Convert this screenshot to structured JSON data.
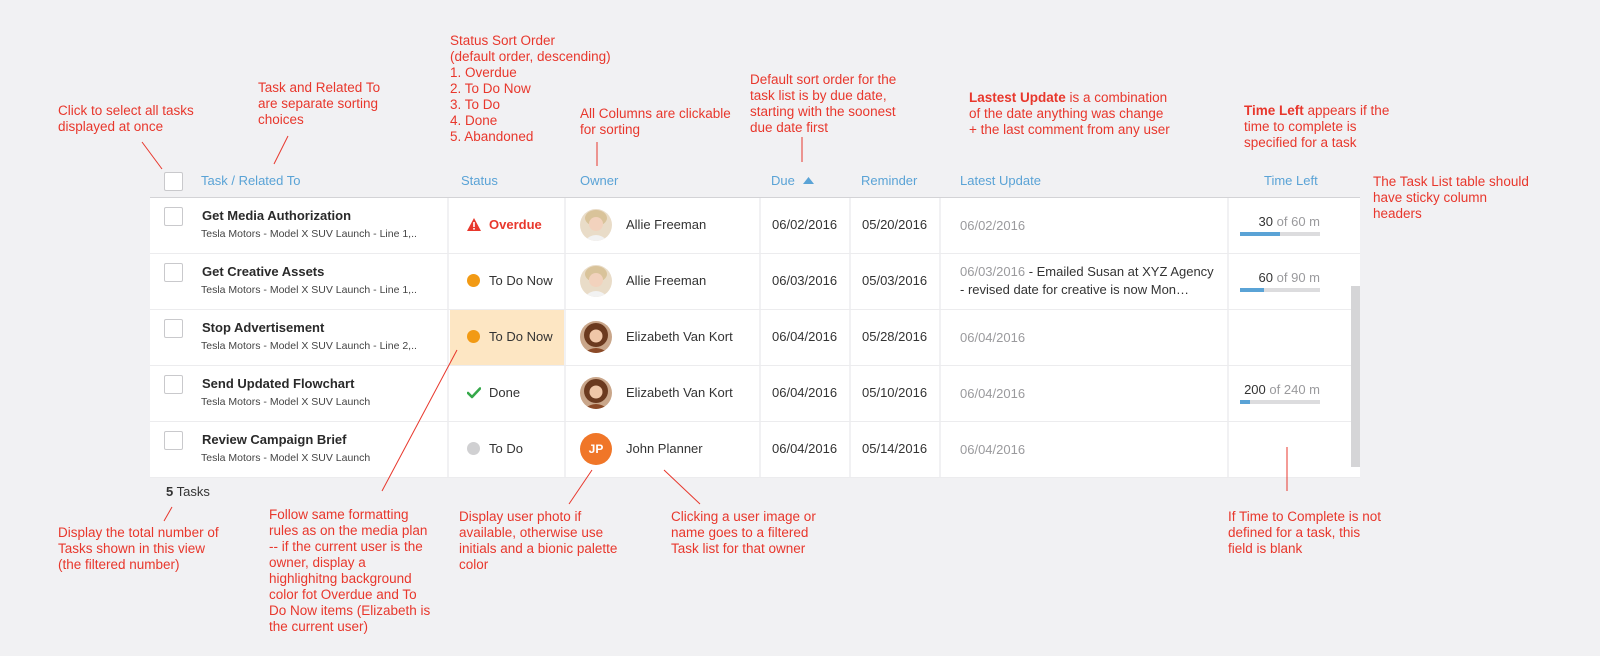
{
  "annotations": {
    "select_all": "Click to select all tasks\ndisplayed at once",
    "task_related": "Task and Related To\nare separate sorting\nchoices",
    "status_order": "Status Sort Order\n(default order, descending)\n1. Overdue\n2. To Do Now\n3. To Do\n4. Done\n5. Abandoned",
    "all_columns": "All Columns are clickable\nfor sorting",
    "default_sort": "Default sort order for the\ntask list is by due date,\nstarting with the soonest\ndue date first",
    "latest_update_bold": "Lastest Update",
    "latest_update_rest": " is a combination\nof the date anything was change\n+ the last comment from any user",
    "time_left_bold": "Time Left",
    "time_left_rest": " appears if the\ntime to complete is\nspecified for a task",
    "sticky": "The Task List table should\nhave sticky column\nheaders",
    "total_count": "Display the total number of\nTasks shown in this view\n(the filtered number)",
    "formatting": "Follow same formatting\nrules as on the media plan\n-- if the current user is the\nowner, display a\nhighlighitng background\ncolor fot Overdue and To\nDo Now items (Elizabeth is\nthe current user)",
    "user_photo": "Display user photo if\navailable, otherwise use\ninitials and a bionic palette\ncolor",
    "click_user": "Clicking a user image or\nname goes to a filtered\nTask list for that owner",
    "time_blank": "If Time to Complete is not\ndefined for a task, this\nfield is blank"
  },
  "headers": {
    "task": "Task / Related To",
    "status": "Status",
    "owner": "Owner",
    "due": "Due",
    "reminder": "Reminder",
    "latest_update": "Latest Update",
    "time_left": "Time Left"
  },
  "sort_icon": "caret-up-icon",
  "rows": [
    {
      "title": "Get Media Authorization",
      "related": "Tesla Motors - Model X SUV Launch - Line 1,..",
      "status": "Overdue",
      "status_icon": "warning-icon",
      "highlight": false,
      "owner": "Allie Freeman",
      "avatar": "photo-allie",
      "due": "06/02/2016",
      "reminder": "05/20/2016",
      "update_date": "06/02/2016",
      "update_comment": "",
      "time_used": "30",
      "time_total": "of 60 m",
      "time_fraction": 0.5
    },
    {
      "title": "Get Creative Assets",
      "related": "Tesla Motors - Model X SUV Launch - Line 1,..",
      "status": "To Do Now",
      "status_icon": "orange-dot-icon",
      "highlight": false,
      "owner": "Allie Freeman",
      "avatar": "photo-allie",
      "due": "06/03/2016",
      "reminder": "05/03/2016",
      "update_date": "06/03/2016",
      "update_comment": " - Emailed Susan at XYZ Agency - revised date for creative is now Mon…",
      "time_used": "60",
      "time_total": "of 90 m",
      "time_fraction": 0.3
    },
    {
      "title": "Stop Advertisement",
      "related": "Tesla Motors - Model X SUV Launch - Line 2,..",
      "status": "To Do Now",
      "status_icon": "orange-dot-icon",
      "highlight": true,
      "owner": "Elizabeth Van Kort",
      "avatar": "photo-elizabeth",
      "due": "06/04/2016",
      "reminder": "05/28/2016",
      "update_date": "06/04/2016",
      "update_comment": "",
      "time_used": "",
      "time_total": "",
      "time_fraction": null
    },
    {
      "title": "Send Updated Flowchart",
      "related": "Tesla Motors - Model X SUV Launch",
      "status": "Done",
      "status_icon": "checkmark-icon",
      "highlight": false,
      "owner": "Elizabeth Van Kort",
      "avatar": "photo-elizabeth",
      "due": "06/04/2016",
      "reminder": "05/10/2016",
      "update_date": "06/04/2016",
      "update_comment": "",
      "time_used": "200",
      "time_total": "of 240 m",
      "time_fraction": 0.12
    },
    {
      "title": "Review Campaign Brief",
      "related": "Tesla Motors - Model X SUV Launch",
      "status": "To Do",
      "status_icon": "gray-dot-icon",
      "highlight": false,
      "owner": "John Planner",
      "avatar": "initials",
      "initials": "JP",
      "due": "06/04/2016",
      "reminder": "05/14/2016",
      "update_date": "06/04/2016",
      "update_comment": "",
      "time_used": "",
      "time_total": "",
      "time_fraction": null
    }
  ],
  "footer": {
    "count": "5",
    "label": " Tasks"
  },
  "colors": {
    "accent": "#5aa3d6",
    "annotation": "#e8372c",
    "overdue": "#e8372c",
    "todo_now": "#f29a14",
    "done": "#35a84a",
    "highlight": "#fde6c3",
    "initials_bg": "#f07628"
  }
}
